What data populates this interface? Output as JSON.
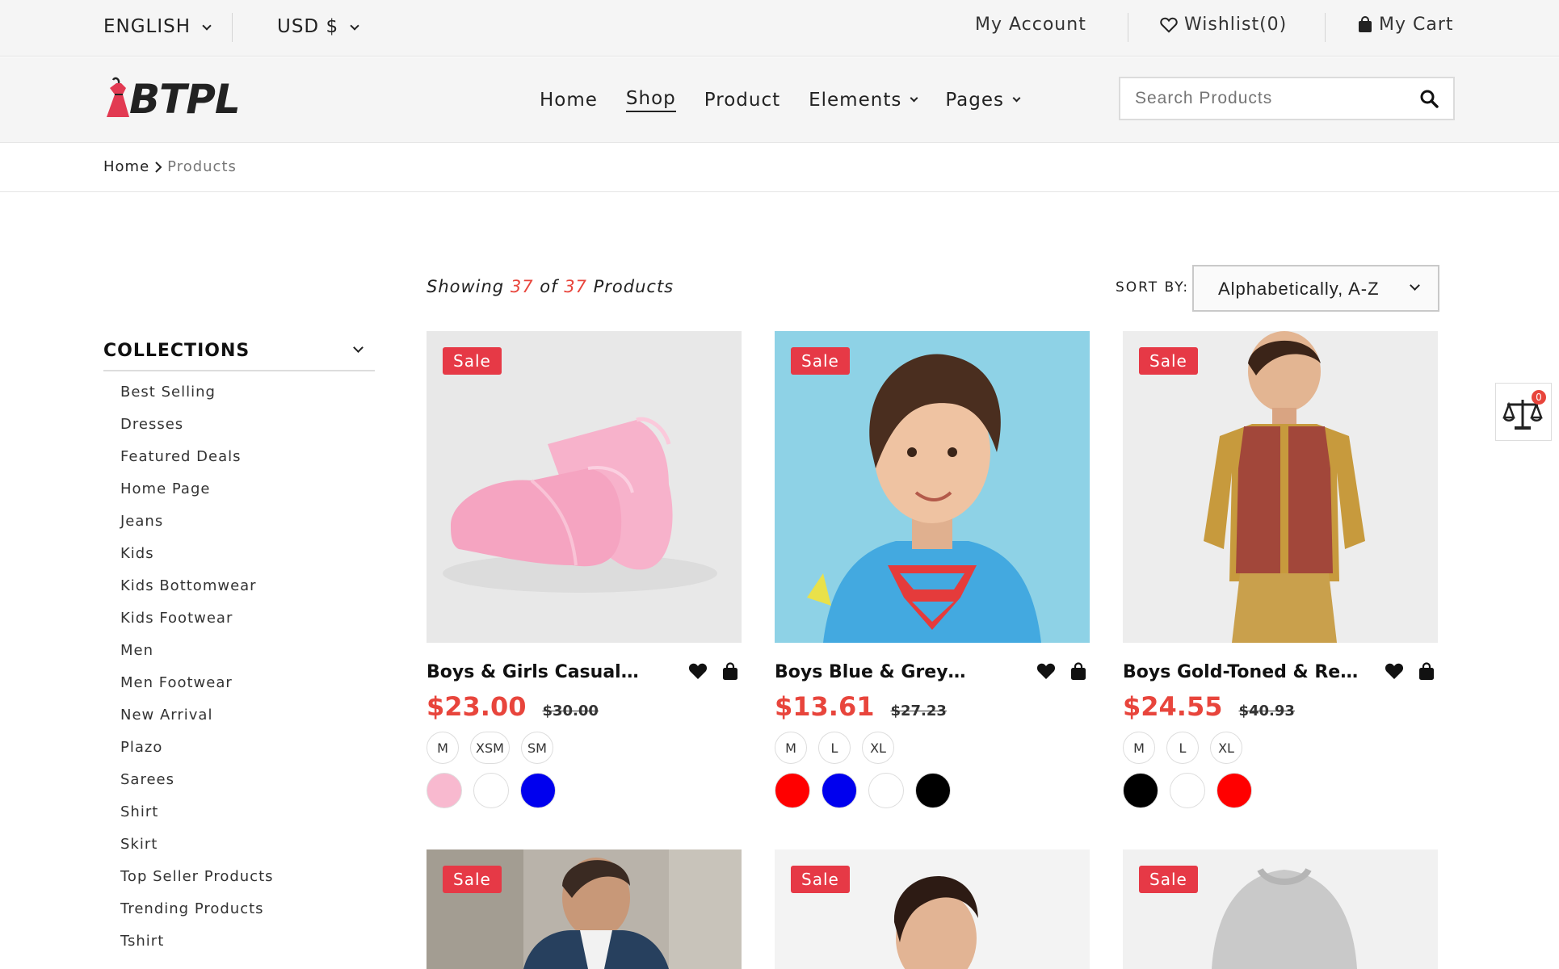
{
  "topbar": {
    "language": "ENGLISH",
    "currency": "USD $",
    "my_account": "My Account",
    "wishlist": "Wishlist(0)",
    "my_cart": "My Cart"
  },
  "header": {
    "logo_text": "BTPL",
    "nav": [
      {
        "label": "Home"
      },
      {
        "label": "Shop"
      },
      {
        "label": "Product"
      },
      {
        "label": "Elements"
      },
      {
        "label": "Pages"
      }
    ],
    "search_placeholder": "Search Products"
  },
  "breadcrumb": {
    "home": "Home",
    "current": "Products"
  },
  "sidebar": {
    "title": "COLLECTIONS",
    "items": [
      "Best Selling",
      "Dresses",
      "Featured Deals",
      "Home Page",
      "Jeans",
      "Kids",
      "Kids Bottomwear",
      "Kids Footwear",
      "Men",
      "Men Footwear",
      "New Arrival",
      "Plazo",
      "Sarees",
      "Shirt",
      "Skirt",
      "Top Seller Products",
      "Trending Products",
      "Tshirt"
    ]
  },
  "toolbar": {
    "showing_prefix": "Showing",
    "showing_count": "37",
    "showing_of": "of",
    "showing_total": "37",
    "showing_suffix": "Products",
    "sort_label": "SORT BY:",
    "sort_value": "Alphabetically, A-Z"
  },
  "sale_label": "Sale",
  "products": [
    {
      "name": "Boys & Girls Casual…",
      "price": "$23.00",
      "compare_price": "$30.00",
      "sizes": [
        "M",
        "XSM",
        "SM"
      ],
      "colors": [
        "#f8b9cf",
        "#ffffff",
        "#0000ee"
      ]
    },
    {
      "name": "Boys Blue & Grey…",
      "price": "$13.61",
      "compare_price": "$27.23",
      "sizes": [
        "M",
        "L",
        "XL"
      ],
      "colors": [
        "#ff0000",
        "#0000ee",
        "#ffffff",
        "#000000"
      ]
    },
    {
      "name": "Boys Gold-Toned & Re…",
      "price": "$24.55",
      "compare_price": "$40.93",
      "sizes": [
        "M",
        "L",
        "XL"
      ],
      "colors": [
        "#000000",
        "#ffffff",
        "#ff0000"
      ]
    }
  ],
  "compare_count": "0",
  "colors": {
    "accent": "#e8453c",
    "sale_badge": "#e63946"
  }
}
